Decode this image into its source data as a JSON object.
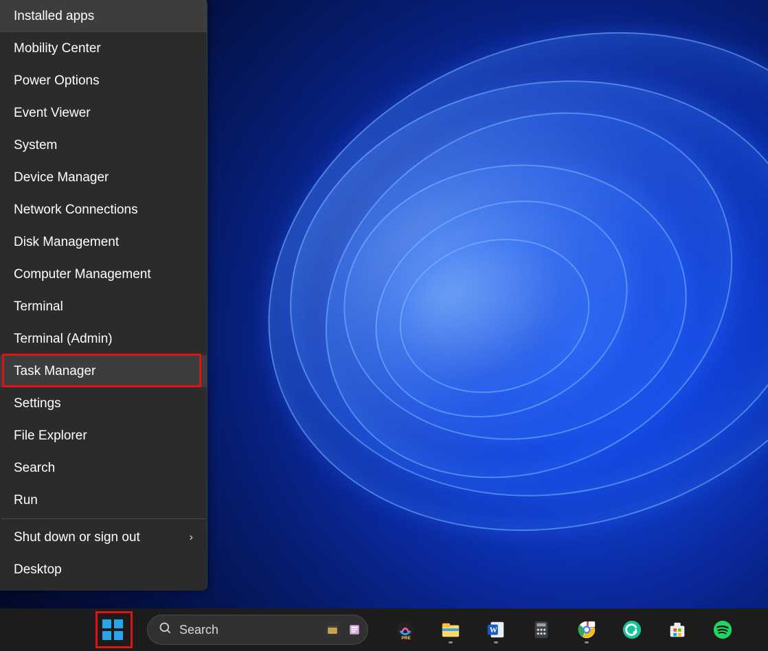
{
  "menu": {
    "items": [
      {
        "label": "Installed apps"
      },
      {
        "label": "Mobility Center"
      },
      {
        "label": "Power Options"
      },
      {
        "label": "Event Viewer"
      },
      {
        "label": "System"
      },
      {
        "label": "Device Manager"
      },
      {
        "label": "Network Connections"
      },
      {
        "label": "Disk Management"
      },
      {
        "label": "Computer Management"
      },
      {
        "label": "Terminal"
      },
      {
        "label": "Terminal (Admin)"
      },
      {
        "label": "Task Manager",
        "highlighted": true,
        "hovered": true
      },
      {
        "label": "Settings"
      },
      {
        "label": "File Explorer"
      },
      {
        "label": "Search"
      },
      {
        "label": "Run"
      },
      {
        "separator": true
      },
      {
        "label": "Shut down or sign out",
        "submenu": true
      },
      {
        "label": "Desktop"
      }
    ]
  },
  "taskbar": {
    "start_highlighted": true,
    "search_label": "Search",
    "search_minis": [
      "clapper-icon",
      "news-icon"
    ],
    "apps": [
      {
        "name": "copilot-icon",
        "running": false
      },
      {
        "name": "file-explorer-icon",
        "running": true
      },
      {
        "name": "word-icon",
        "running": true
      },
      {
        "name": "calculator-icon",
        "running": false
      },
      {
        "name": "chrome-icon",
        "running": true
      },
      {
        "name": "grammarly-icon",
        "running": false
      },
      {
        "name": "microsoft-store-icon",
        "running": false
      },
      {
        "name": "spotify-icon",
        "running": false
      }
    ]
  }
}
